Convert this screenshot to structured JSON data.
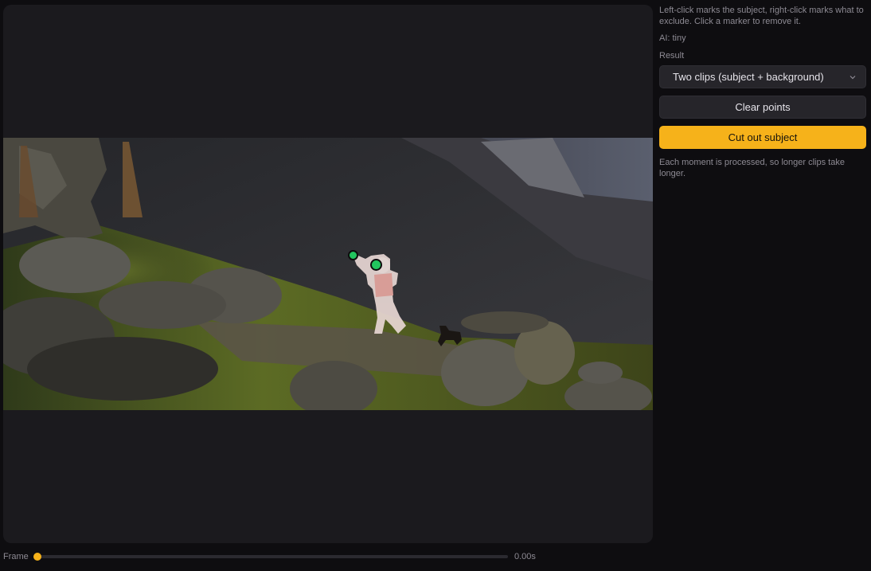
{
  "sidebar": {
    "help_text": "Left-click marks the subject, right-click marks what to exclude. Click a marker to remove it.",
    "ai_label": "AI: tiny",
    "result_label": "Result",
    "result_select": {
      "value": "Two clips (subject + background)",
      "icon": "chevron-down-icon"
    },
    "clear_button": "Clear points",
    "cutout_button": "Cut out subject",
    "note": "Each moment is processed, so longer clips take longer."
  },
  "timeline": {
    "label": "Frame",
    "time": "0.00s",
    "position": 0
  },
  "markers": [
    {
      "type": "subject",
      "color": "#22c55e"
    },
    {
      "type": "subject",
      "color": "#22c55e"
    }
  ],
  "colors": {
    "accent": "#f6b21a",
    "marker": "#22c55e"
  }
}
